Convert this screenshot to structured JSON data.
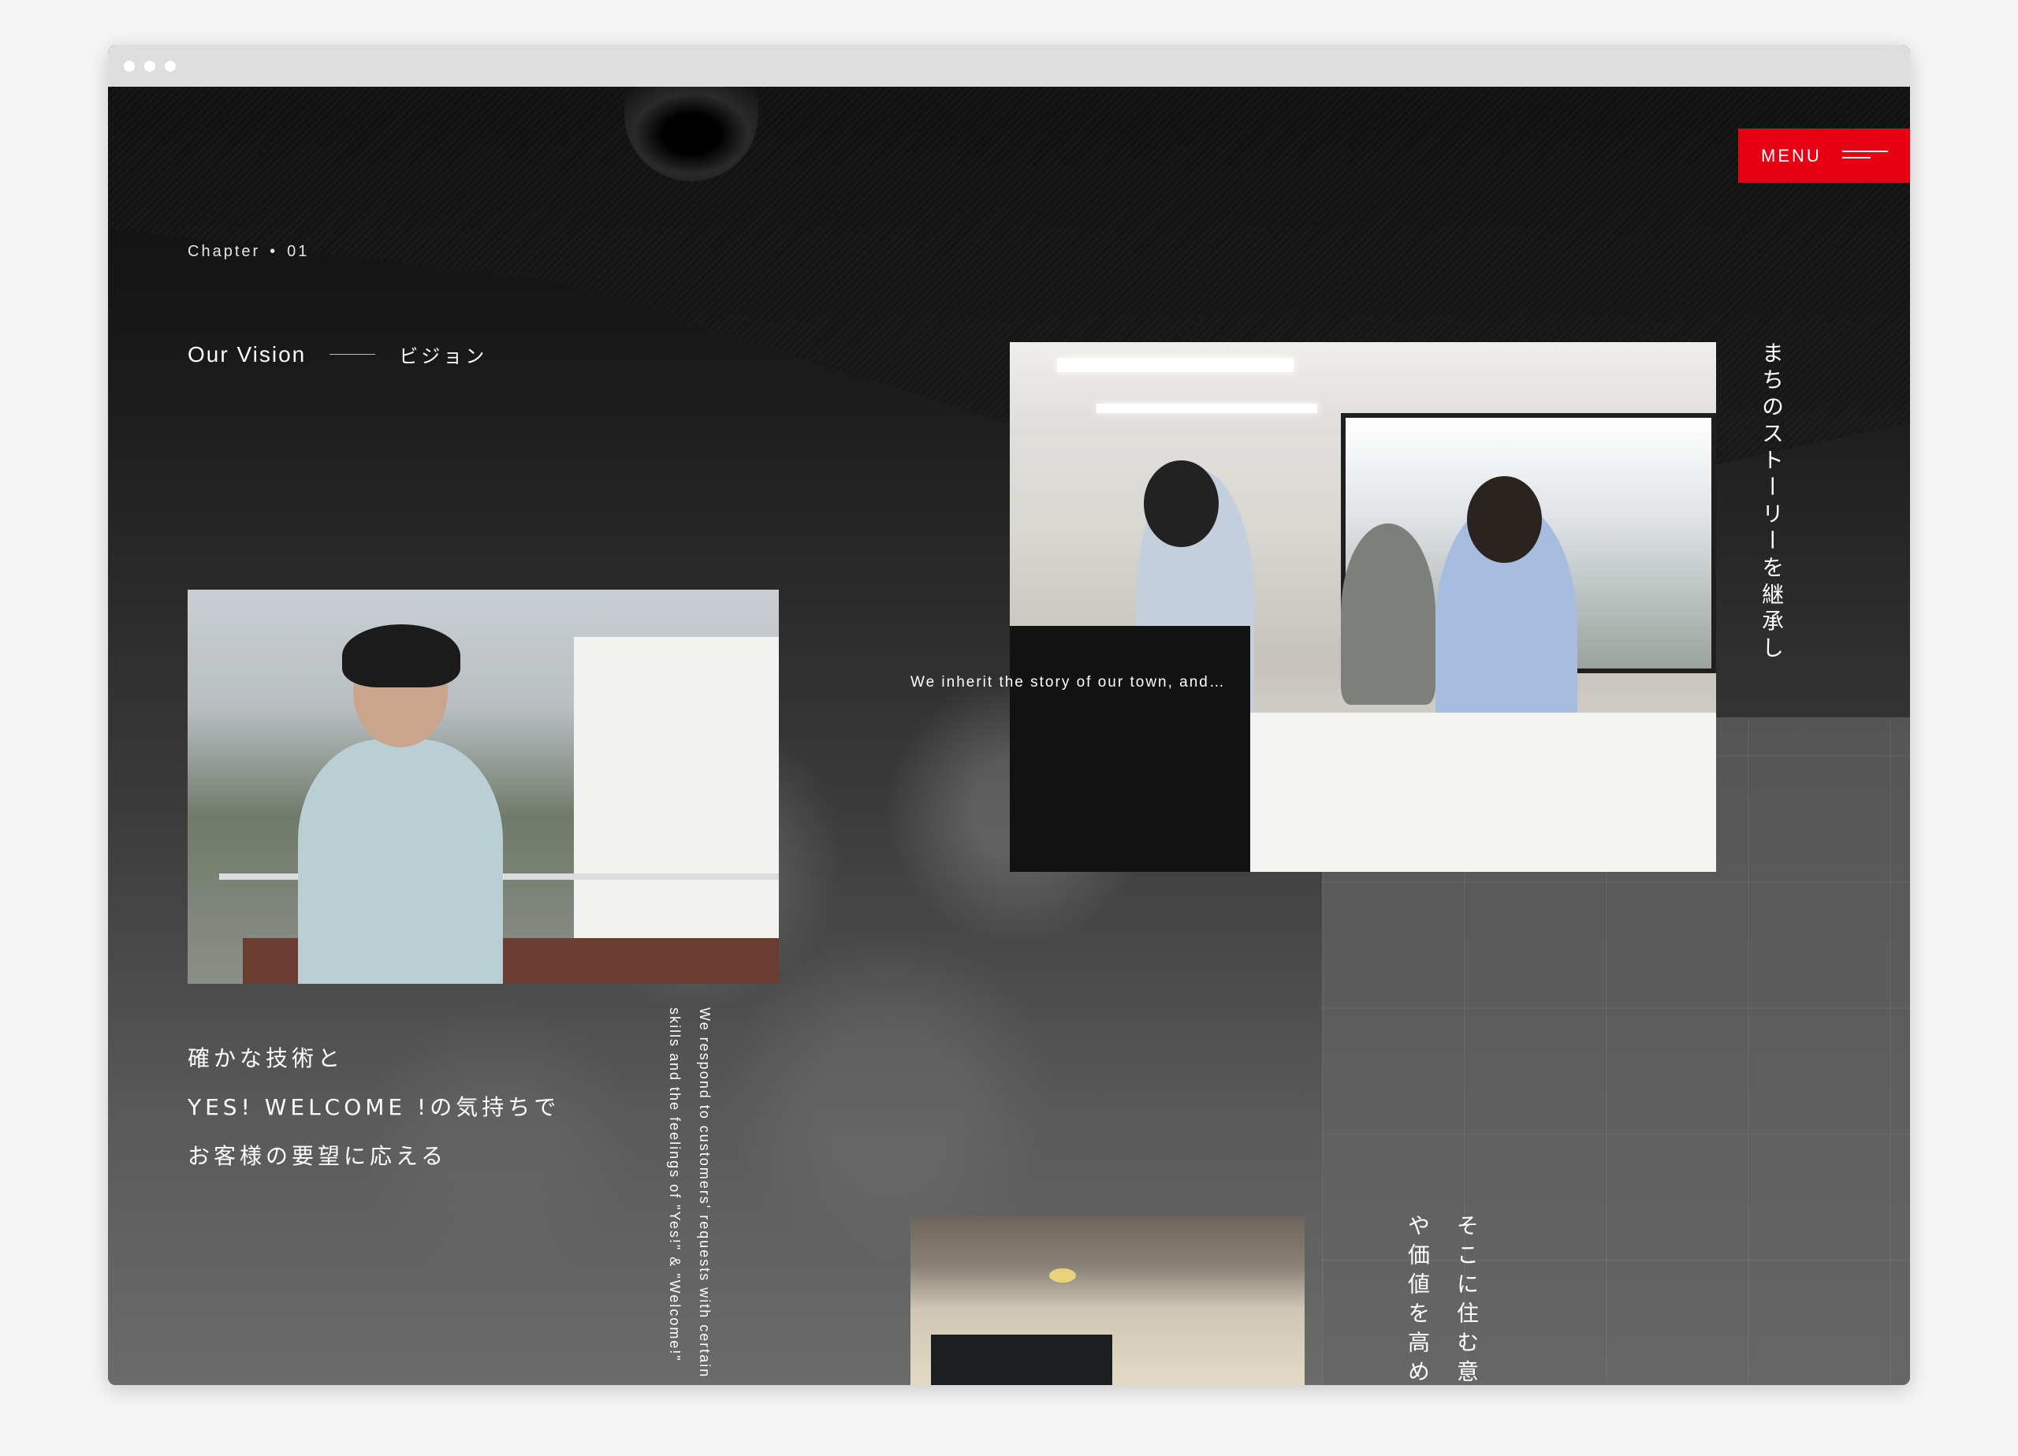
{
  "window": {
    "controls": [
      "dot",
      "dot",
      "dot"
    ]
  },
  "header": {
    "chapter_label": "Chapter",
    "chapter_separator": "•",
    "chapter_number": "01",
    "vision_title": "Our Vision",
    "vision_title_jp": "ビジョン"
  },
  "menu": {
    "label": "MENU",
    "icon": "hamburger-icon",
    "color": "#e60012"
  },
  "main": {
    "caption_inherit": "We inherit the story of our town, and…",
    "vertical_jp_1": "まちのストーリーを継承し",
    "headline_lines": [
      "確かな技術と",
      "YES! WELCOME !の気持ちで",
      "お客様の要望に応える"
    ],
    "vertical_en": "We respond to customers' requests with certain skills and the feelings of \"Yes!\" & \"Welcome!\"",
    "vertical_jp_2": "そこに住む意味や価値を高める"
  },
  "images": [
    {
      "name": "office-team-photo",
      "description": "Three staff reviewing drawings at an office desk"
    },
    {
      "name": "president-portrait-photo",
      "description": "Man in light work jacket on a rooftop balcony"
    },
    {
      "name": "building-entrance-photo",
      "description": "Building entrance with ceiling light"
    }
  ]
}
